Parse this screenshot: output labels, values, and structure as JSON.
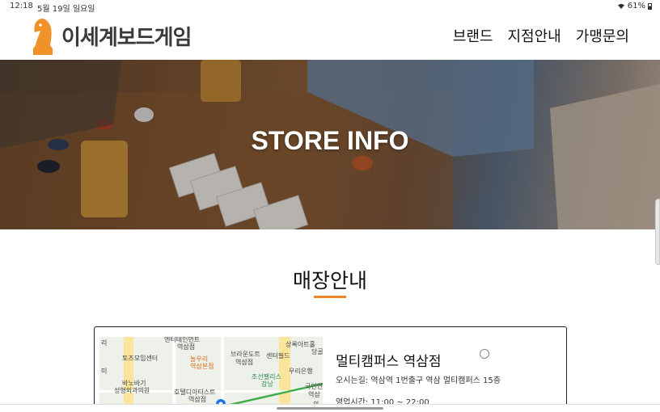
{
  "status_bar": {
    "time": "12:18",
    "date": "5월 19일 일요일",
    "battery": "61%"
  },
  "header": {
    "logo_text": "이세계보드게임",
    "logo_color": "#f0922a",
    "nav": [
      "브랜드",
      "지점안내",
      "가맹문의"
    ]
  },
  "hero": {
    "title": "STORE INFO"
  },
  "section": {
    "title": "매장안내",
    "accent_color": "#f0822a"
  },
  "store": {
    "name": "멀티캠퍼스 역삼점",
    "address": "오시는길: 역삼역 1번출구 역삼 멀티캠퍼스 15층",
    "hours": "영업시간: 11:00 ~ 22:00",
    "map_labels": [
      "엔터테인먼트",
      "역삼점",
      "토즈모임센터",
      "놀우리",
      "역삼본점",
      "브라운도트",
      "역삼점",
      "센터필드",
      "상록아트홀",
      "당골",
      "리",
      "미",
      "바노바기",
      "성형외과의원",
      "호텔디아티스트",
      "역삼점",
      "조선팰리스",
      "강남",
      "우리은행",
      "국민연",
      "역삼",
      "의"
    ]
  }
}
